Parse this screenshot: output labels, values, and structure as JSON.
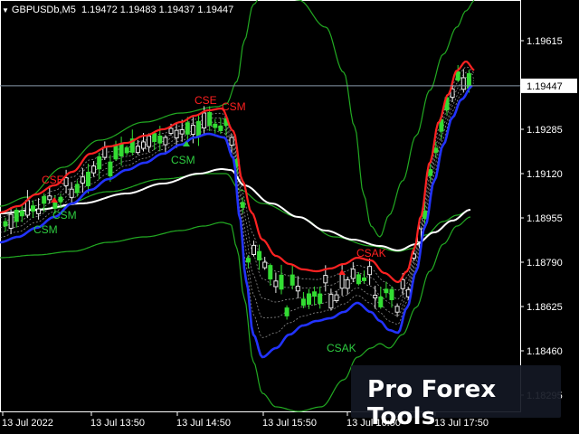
{
  "header": {
    "symbol": "GBPUSDb,M5",
    "ohlc": "1.19472 1.19483 1.19437 1.19447"
  },
  "price_axis": {
    "ticks": [
      "1.19615",
      "1.19285",
      "1.19120",
      "1.18955",
      "1.18790",
      "1.18625",
      "1.18460",
      "1.18295"
    ],
    "current_price": "1.19447"
  },
  "time_axis": {
    "ticks": [
      "13 Jul 2022",
      "13 Jul 13:50",
      "13 Jul 14:50",
      "13 Jul 15:50",
      "13 Jul 16:50",
      "13 Jul 17:50"
    ]
  },
  "signal_labels": [
    {
      "text": "CSE",
      "color": "#ff2020"
    },
    {
      "text": "CSM",
      "color": "#2ecc40"
    },
    {
      "text": "CSM",
      "color": "#2ecc40"
    },
    {
      "text": "CSE",
      "color": "#ff2020"
    },
    {
      "text": "CSM",
      "color": "#ff2020"
    },
    {
      "text": "CSM",
      "color": "#2ecc40"
    },
    {
      "text": "CSAK",
      "color": "#ff2020"
    },
    {
      "text": "CSAK",
      "color": "#2ecc40"
    }
  ],
  "watermark": "Pro Forex Tools",
  "colors": {
    "background": "#000000",
    "grid": "#ffffff",
    "bull_candle": "#33dd33",
    "bear_candle": "#e8e8e8",
    "bollinger": "#22aa22",
    "ma_slow": "#ffffff",
    "ma_red": "#ff2222",
    "ma_blue": "#2233ff"
  },
  "chart_data": {
    "type": "candlestick",
    "symbol": "GBPUSDb,M5",
    "ylim": [
      1.1825,
      1.1975
    ],
    "x_ticks": [
      "13 Jul 2022",
      "13 Jul 13:50",
      "13 Jul 14:50",
      "13 Jul 15:50",
      "13 Jul 16:50",
      "13 Jul 17:50"
    ],
    "last_price": 1.19447
  }
}
